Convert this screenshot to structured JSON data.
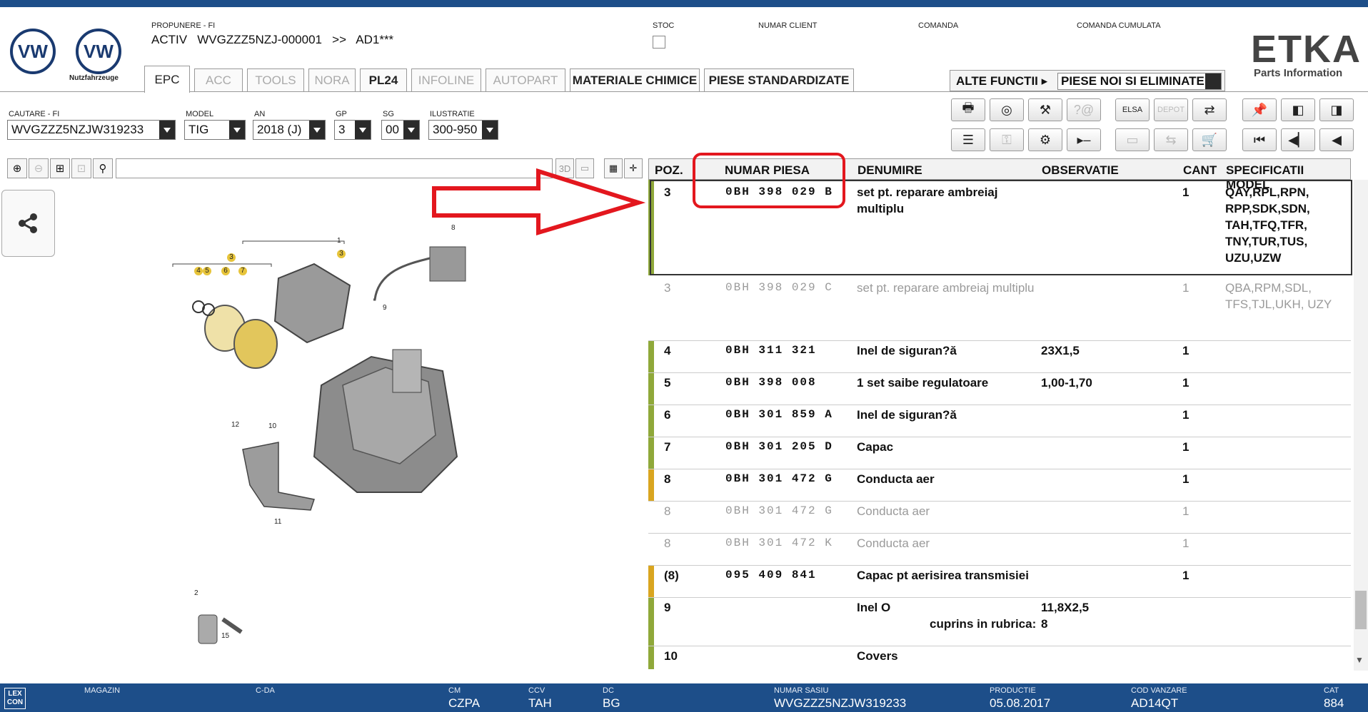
{
  "header": {
    "propunere_label": "PROPUNERE - FI",
    "activ_line": "ACTIV   WVGZZZ5NZJ-000001   >>   AD1***",
    "nutzfahrzeuge": "Nutzfahrzeuge",
    "stoc_label": "STOC",
    "numar_client_label": "NUMAR CLIENT",
    "comanda_label": "COMANDA",
    "comanda_cumulata_label": "COMANDA CUMULATA",
    "brand": "ETKA",
    "brand_sub": "Parts Information"
  },
  "tabs": [
    {
      "label": "EPC",
      "state": "active"
    },
    {
      "label": "ACC",
      "state": "disabled"
    },
    {
      "label": "TOOLS",
      "state": "disabled"
    },
    {
      "label": "NORA",
      "state": "disabled"
    },
    {
      "label": "PL24",
      "state": "enabled"
    },
    {
      "label": "INFOLINE",
      "state": "disabled"
    },
    {
      "label": "AUTOPART",
      "state": "disabled"
    },
    {
      "label": "MATERIALE CHIMICE",
      "state": "enabled"
    },
    {
      "label": "PIESE STANDARDIZATE",
      "state": "enabled"
    }
  ],
  "alte_functii": {
    "label": "ALTE FUNCTII ▸",
    "selected": "PIESE NOI SI ELIMINATE"
  },
  "search": {
    "cautare_label": "CAUTARE - FI",
    "cautare_value": "WVGZZZ5NZJW319233",
    "model_label": "MODEL",
    "model_value": "TIG",
    "an_label": "AN",
    "an_value": "2018 (J)",
    "gp_label": "GP",
    "gp_value": "3",
    "sg_label": "SG",
    "sg_value": "00",
    "ilustratie_label": "ILUSTRATIE",
    "ilustratie_value": "300-950"
  },
  "toolbar_icons": [
    {
      "name": "print-icon",
      "glyph": "🖶"
    },
    {
      "name": "service-icon",
      "glyph": "◎"
    },
    {
      "name": "tools-icon",
      "glyph": "⚒"
    },
    {
      "name": "help-icon",
      "glyph": "?@"
    },
    {
      "name": "elsa-icon",
      "glyph": "ELSA"
    },
    {
      "name": "depot-icon",
      "glyph": "DEPOT"
    },
    {
      "name": "cart-transfer-icon",
      "glyph": "⇄"
    },
    {
      "name": "pin-icon",
      "glyph": "📌"
    },
    {
      "name": "page-back-icon",
      "glyph": "◧"
    },
    {
      "name": "page-forward-icon",
      "glyph": "◨"
    },
    {
      "name": "list-icon",
      "glyph": "☰"
    },
    {
      "name": "key-icon",
      "glyph": "⚿"
    },
    {
      "name": "engine-icon",
      "glyph": "⚙"
    },
    {
      "name": "play-minus-icon",
      "glyph": "▸–"
    },
    {
      "name": "compare-icon",
      "glyph": "▭"
    },
    {
      "name": "exchange-icon",
      "glyph": "⇆"
    },
    {
      "name": "cart-icon",
      "glyph": "🛒"
    },
    {
      "name": "first-icon",
      "glyph": "⏮"
    },
    {
      "name": "previous-icon",
      "glyph": "◀▏"
    },
    {
      "name": "back-icon",
      "glyph": "◀"
    }
  ],
  "table": {
    "headers": {
      "poz": "POZ.",
      "numar": "NUMAR PIESA",
      "denumire": "DENUMIRE",
      "observatie": "OBSERVATIE",
      "cant": "CANT",
      "spec": "SPECIFICATII MODEL"
    },
    "rows": [
      {
        "poz": "3",
        "numar": "0BH 398 029 B",
        "denumire": "set pt. reparare ambreiaj multiplu",
        "obs": "",
        "cant": "1",
        "spec": "QAY,RPL,RPN, RPP,SDK,SDN, TAH,TFQ,TFR, TNY,TUR,TUS, UZU,UZW",
        "bar": "#8fa83a",
        "faded": false
      },
      {
        "poz": "3",
        "numar": "0BH 398 029 C",
        "denumire": "set pt. reparare ambreiaj multiplu",
        "obs": "",
        "cant": "1",
        "spec": "QBA,RPM,SDL, TFS,TJL,UKH, UZY",
        "bar": "",
        "faded": true
      },
      {
        "poz": "4",
        "numar": "0BH 311 321",
        "denumire": "Inel de siguran?ă",
        "obs": "23X1,5",
        "cant": "1",
        "spec": "",
        "bar": "#8fa83a",
        "faded": false
      },
      {
        "poz": "5",
        "numar": "0BH 398 008",
        "denumire": "1 set saibe regulatoare",
        "obs": "1,00-1,70",
        "cant": "1",
        "spec": "",
        "bar": "#8fa83a",
        "faded": false
      },
      {
        "poz": "6",
        "numar": "0BH 301 859 A",
        "denumire": "Inel de siguran?ă",
        "obs": "",
        "cant": "1",
        "spec": "",
        "bar": "#8fa83a",
        "faded": false
      },
      {
        "poz": "7",
        "numar": "0BH 301 205 D",
        "denumire": "Capac",
        "obs": "",
        "cant": "1",
        "spec": "",
        "bar": "#8fa83a",
        "faded": false
      },
      {
        "poz": "8",
        "numar": "0BH 301 472 G",
        "denumire": "Conducta aer",
        "obs": "",
        "cant": "1",
        "spec": "",
        "bar": "#d9a520",
        "faded": false
      },
      {
        "poz": "8",
        "numar": "0BH 301 472 G",
        "denumire": "Conducta aer",
        "obs": "",
        "cant": "1",
        "spec": "",
        "bar": "",
        "faded": true
      },
      {
        "poz": "8",
        "numar": "0BH 301 472 K",
        "denumire": "Conducta aer",
        "obs": "",
        "cant": "1",
        "spec": "",
        "bar": "",
        "faded": true
      },
      {
        "poz": "(8)",
        "numar": "095 409 841",
        "denumire": "Capac pt aerisirea transmisiei",
        "obs": "",
        "cant": "1",
        "spec": "",
        "bar": "#d9a520",
        "faded": false
      },
      {
        "poz": "9",
        "numar": "",
        "denumire": "Inel O",
        "obs": "11,8X2,5",
        "cant": "",
        "spec": "",
        "bar": "#8fa83a",
        "faded": false,
        "sub_label": "cuprins in rubrica:",
        "sub_value": "8"
      },
      {
        "poz": "10",
        "numar": "",
        "denumire": "Covers",
        "obs": "",
        "cant": "",
        "spec": "",
        "bar": "#8fa83a",
        "faded": false
      }
    ]
  },
  "diagram_callouts": [
    "1",
    "3",
    "8",
    "9",
    "4",
    "5",
    "6",
    "7",
    "3",
    "12",
    "10",
    "11",
    "2",
    "15"
  ],
  "statusbar": {
    "lexcon": "LEX CON",
    "magazin_label": "MAGAZIN",
    "magazin_value": "",
    "cda_label": "C-DA",
    "cda_value": "",
    "cm_label": "CM",
    "cm_value": "CZPA",
    "ccv_label": "CCV",
    "ccv_value": "TAH",
    "dc_label": "DC",
    "dc_value": "BG",
    "sasiu_label": "NUMAR SASIU",
    "sasiu_value": "WVGZZZ5NZJW319233",
    "productie_label": "PRODUCTIE",
    "productie_value": "05.08.2017",
    "cod_label": "COD VANZARE",
    "cod_value": "AD14QT",
    "cat_label": "CAT",
    "cat_value": "884"
  },
  "colors": {
    "brand_blue": "#1d4e89",
    "bar_green": "#8fa83a",
    "bar_yellow": "#d9a520",
    "annotation_red": "#e3171e"
  }
}
